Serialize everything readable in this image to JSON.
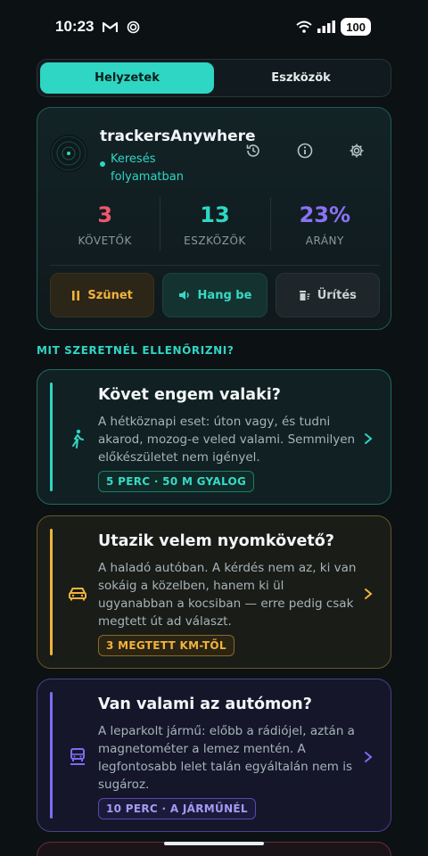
{
  "status_bar": {
    "time": "10:23",
    "battery": "100"
  },
  "tabs": [
    {
      "label": "Helyzetek",
      "active": true
    },
    {
      "label": "Eszközök",
      "active": false
    }
  ],
  "status": {
    "app_name": "trackersAnywhere",
    "state": "Keresés folyamatban",
    "stats": [
      {
        "value": "3",
        "label": "KÖVETŐK",
        "color": "#f0566f"
      },
      {
        "value": "13",
        "label": "ESZKÖZÖK",
        "color": "#2fd6c4"
      },
      {
        "value": "23%",
        "label": "ARÁNY",
        "color": "#8a72f5"
      }
    ],
    "actions": {
      "pause": "Szünet",
      "sound": "Hang be",
      "clear": "Ürítés"
    }
  },
  "section_title": "MIT SZERETNÉL ELLENŐRIZNI?",
  "scenarios": [
    {
      "title": "Követ engem valaki?",
      "desc": "A hétköznapi eset: úton vagy, és tudni akarod, mozog-e veled valami. Semmilyen előkészületet nem igényel.",
      "badge": "5 PERC · 50 M GYALOG",
      "icon": "walking-person-icon",
      "color": "#2fd6c4"
    },
    {
      "title": "Utazik velem nyomkövető?",
      "desc": "A haladó autóban. A kérdés nem az, ki van sokáig a közelben, hanem ki ül ugyanabban a kocsiban — erre pedig csak megtett út ad választ.",
      "badge": "3 MEGTETT KM-TŐL",
      "icon": "car-icon",
      "color": "#f2b33c"
    },
    {
      "title": "Van valami az autómon?",
      "desc": "A leparkolt jármű: előbb a rádiójel, aztán a magnetométer a lemez mentén. A legfontosabb lelet talán egyáltalán nem is sugároz.",
      "badge": "10 PERC · A JÁRMŰNÉL",
      "icon": "parked-car-icon",
      "color": "#7d6df0"
    }
  ]
}
